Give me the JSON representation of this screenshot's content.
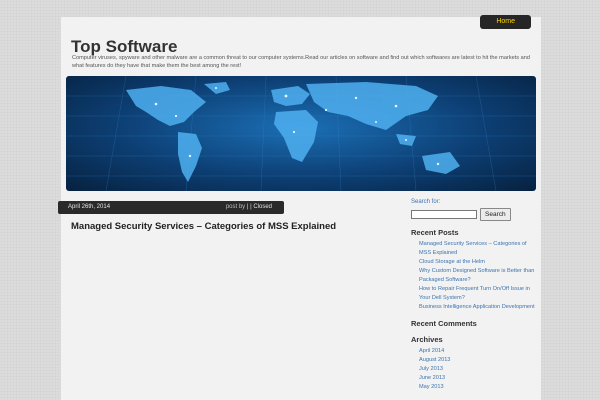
{
  "nav": {
    "items": [
      {
        "label": "Home"
      }
    ]
  },
  "site": {
    "title": "Top Software",
    "tagline": "Computer viruses, spyware and other malware are a common threat to our computer systems.Read our articles on software and find out which softwares are latest to hit the markets and what features do they have that make them the best among the rest!"
  },
  "post": {
    "date": "April 26th, 2014",
    "meta_prefix": "post by",
    "meta_sep": "|",
    "meta_status": "| Closed",
    "title": "Managed Security Services – Categories of MSS Explained"
  },
  "sidebar": {
    "search": {
      "label": "Search for:",
      "button": "Search",
      "value": ""
    },
    "recent_posts": {
      "title": "Recent Posts",
      "items": [
        "Managed Security Services – Categories of MSS Explained",
        "Cloud Storage at the Helm",
        "Why Custom Designed Software is Better than Packaged Software?",
        "How to Repair Frequent Turn On/Off Issue in Your Dell System?",
        "Business Intelligence Application Development"
      ]
    },
    "recent_comments": {
      "title": "Recent Comments"
    },
    "archives": {
      "title": "Archives",
      "items": [
        "April 2014",
        "August 2013",
        "July 2013",
        "June 2013",
        "May 2013"
      ]
    }
  },
  "colors": {
    "nav_bg": "#262626",
    "nav_text": "#ffd400",
    "link": "#3b73b0",
    "post_bar": "#2a2a2a"
  }
}
